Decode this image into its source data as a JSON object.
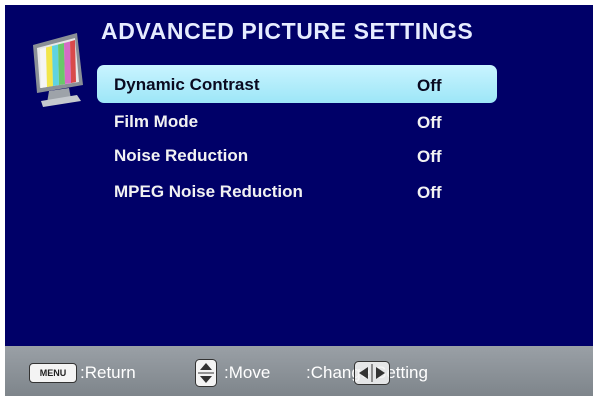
{
  "header": {
    "title": "ADVANCED PICTURE SETTINGS",
    "icon": "tv-monitor-icon"
  },
  "menu": {
    "items": [
      {
        "label": "Dynamic Contrast",
        "value": "Off",
        "selected": true
      },
      {
        "label": "Film Mode",
        "value": "Off",
        "selected": false
      },
      {
        "label": "Noise Reduction",
        "value": "Off",
        "selected": false
      },
      {
        "label": "MPEG Noise Reduction",
        "value": "Off",
        "selected": false
      }
    ]
  },
  "footer": {
    "menu_key": "MENU",
    "return_label": ":Return",
    "move_label": ":Move",
    "change_label": ":Change Setting",
    "icons": [
      "menu-key-icon",
      "updown-key-icon",
      "leftright-key-icon"
    ]
  },
  "colors": {
    "background": "#000068",
    "highlight": "#b8eefb",
    "footer": "#8c9298",
    "text": "#f2f2f2"
  }
}
